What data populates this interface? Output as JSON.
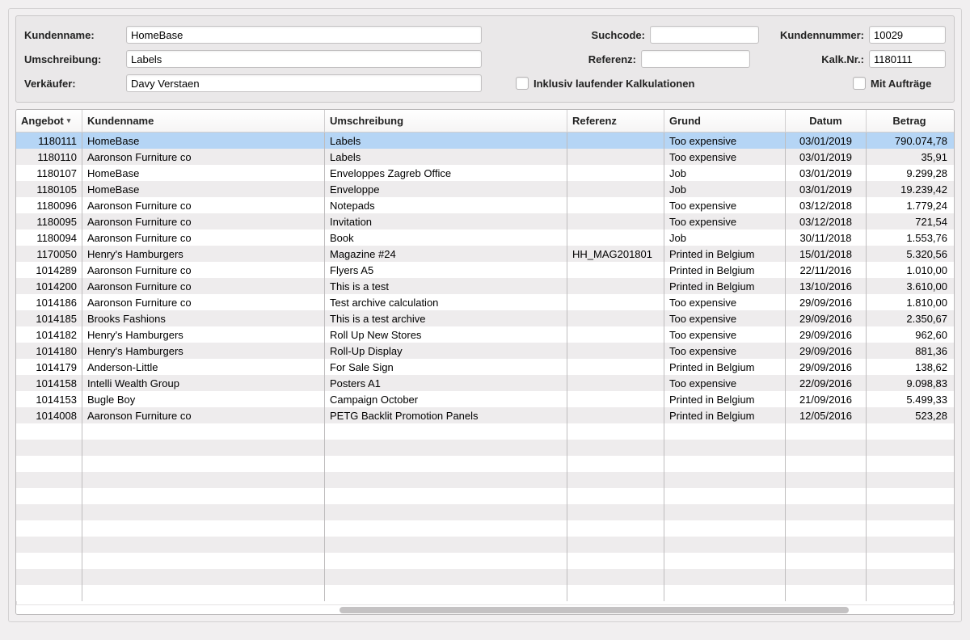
{
  "filters": {
    "kundenname_label": "Kundenname:",
    "kundenname_value": "HomeBase",
    "umschreibung_label": "Umschreibung:",
    "umschreibung_value": "Labels",
    "verkaeufer_label": "Verkäufer:",
    "verkaeufer_value": "Davy Verstaen",
    "suchcode_label": "Suchcode:",
    "suchcode_value": "",
    "referenz_label": "Referenz:",
    "referenz_value": "",
    "inklusiv_label": "Inklusiv laufender Kalkulationen",
    "kundennummer_label": "Kundennummer:",
    "kundennummer_value": "10029",
    "kalknr_label": "Kalk.Nr.:",
    "kalknr_value": "1180111",
    "mit_auftraege_label": "Mit Aufträge"
  },
  "columns": {
    "angebot": "Angebot",
    "kundenname": "Kundenname",
    "umschreibung": "Umschreibung",
    "referenz": "Referenz",
    "grund": "Grund",
    "datum": "Datum",
    "betrag": "Betrag"
  },
  "rows": [
    {
      "angebot": "1180111",
      "kundenname": "HomeBase",
      "umschreibung": "Labels",
      "referenz": "",
      "grund": "Too expensive",
      "datum": "03/01/2019",
      "betrag": "790.074,78",
      "selected": true
    },
    {
      "angebot": "1180110",
      "kundenname": "Aaronson Furniture co",
      "umschreibung": "Labels",
      "referenz": "",
      "grund": "Too expensive",
      "datum": "03/01/2019",
      "betrag": "35,91"
    },
    {
      "angebot": "1180107",
      "kundenname": "HomeBase",
      "umschreibung": "Enveloppes Zagreb Office",
      "referenz": "",
      "grund": "Job",
      "datum": "03/01/2019",
      "betrag": "9.299,28"
    },
    {
      "angebot": "1180105",
      "kundenname": "HomeBase",
      "umschreibung": "Enveloppe",
      "referenz": "",
      "grund": "Job",
      "datum": "03/01/2019",
      "betrag": "19.239,42"
    },
    {
      "angebot": "1180096",
      "kundenname": "Aaronson Furniture co",
      "umschreibung": "Notepads",
      "referenz": "",
      "grund": "Too expensive",
      "datum": "03/12/2018",
      "betrag": "1.779,24"
    },
    {
      "angebot": "1180095",
      "kundenname": "Aaronson Furniture co",
      "umschreibung": "Invitation",
      "referenz": "",
      "grund": "Too expensive",
      "datum": "03/12/2018",
      "betrag": "721,54"
    },
    {
      "angebot": "1180094",
      "kundenname": "Aaronson Furniture co",
      "umschreibung": "Book",
      "referenz": "",
      "grund": "Job",
      "datum": "30/11/2018",
      "betrag": "1.553,76"
    },
    {
      "angebot": "1170050",
      "kundenname": "Henry's Hamburgers",
      "umschreibung": "Magazine #24",
      "referenz": "HH_MAG201801",
      "grund": "Printed in Belgium",
      "datum": "15/01/2018",
      "betrag": "5.320,56"
    },
    {
      "angebot": "1014289",
      "kundenname": "Aaronson Furniture co",
      "umschreibung": "Flyers A5",
      "referenz": "",
      "grund": "Printed in Belgium",
      "datum": "22/11/2016",
      "betrag": "1.010,00"
    },
    {
      "angebot": "1014200",
      "kundenname": "Aaronson Furniture co",
      "umschreibung": "This is a test",
      "referenz": "",
      "grund": "Printed in Belgium",
      "datum": "13/10/2016",
      "betrag": "3.610,00"
    },
    {
      "angebot": "1014186",
      "kundenname": "Aaronson Furniture co",
      "umschreibung": "Test archive calculation",
      "referenz": "",
      "grund": "Too expensive",
      "datum": "29/09/2016",
      "betrag": "1.810,00"
    },
    {
      "angebot": "1014185",
      "kundenname": "Brooks Fashions",
      "umschreibung": "This is a test archive",
      "referenz": "",
      "grund": "Too expensive",
      "datum": "29/09/2016",
      "betrag": "2.350,67"
    },
    {
      "angebot": "1014182",
      "kundenname": "Henry's Hamburgers",
      "umschreibung": "Roll Up New Stores",
      "referenz": "",
      "grund": "Too expensive",
      "datum": "29/09/2016",
      "betrag": "962,60"
    },
    {
      "angebot": "1014180",
      "kundenname": "Henry's Hamburgers",
      "umschreibung": "Roll-Up Display",
      "referenz": "",
      "grund": "Too expensive",
      "datum": "29/09/2016",
      "betrag": "881,36"
    },
    {
      "angebot": "1014179",
      "kundenname": "Anderson-Little",
      "umschreibung": "For Sale Sign",
      "referenz": "",
      "grund": "Printed in Belgium",
      "datum": "29/09/2016",
      "betrag": "138,62"
    },
    {
      "angebot": "1014158",
      "kundenname": "Intelli Wealth Group",
      "umschreibung": "Posters A1",
      "referenz": "",
      "grund": "Too expensive",
      "datum": "22/09/2016",
      "betrag": "9.098,83"
    },
    {
      "angebot": "1014153",
      "kundenname": "Bugle Boy",
      "umschreibung": "Campaign October",
      "referenz": "",
      "grund": "Printed in Belgium",
      "datum": "21/09/2016",
      "betrag": "5.499,33"
    },
    {
      "angebot": "1014008",
      "kundenname": "Aaronson Furniture co",
      "umschreibung": "PETG Backlit Promotion Panels",
      "referenz": "",
      "grund": "Printed in Belgium",
      "datum": "12/05/2016",
      "betrag": "523,28"
    }
  ],
  "empty_rows": 11
}
